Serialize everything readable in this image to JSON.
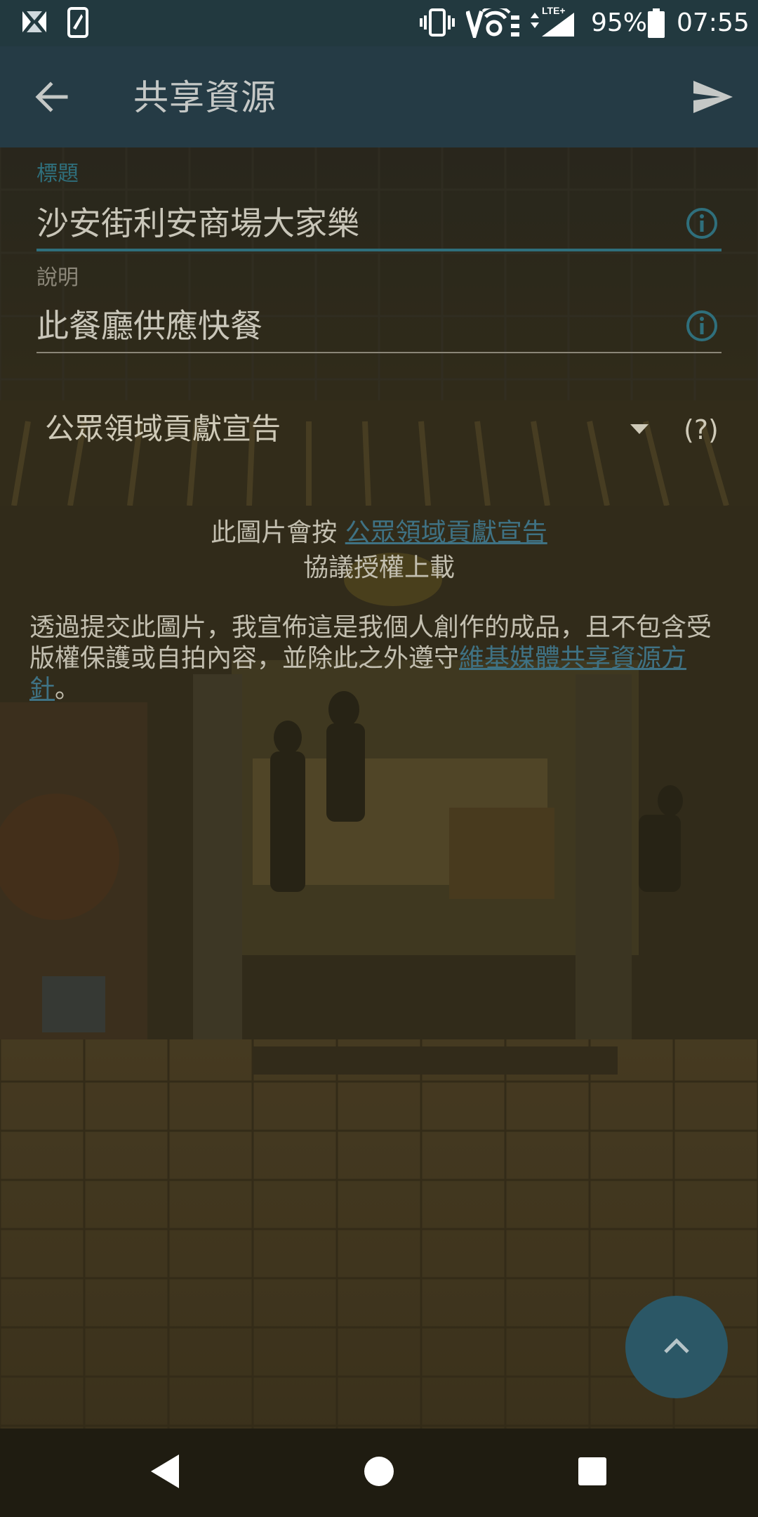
{
  "status_bar": {
    "battery_percent": "95%",
    "time": "07:55",
    "network_label": "LTE+",
    "left_icons": [
      "app-notification-icon",
      "device-notification-icon"
    ],
    "right_icons": [
      "vibrate-icon",
      "volte-wifi-icon",
      "lte-signal-icon",
      "battery-icon"
    ]
  },
  "toolbar": {
    "title": "共享資源",
    "back_icon": "arrow-left-icon",
    "send_icon": "send-icon"
  },
  "form": {
    "title_field": {
      "label": "標題",
      "value": "沙安街利安商場大家樂"
    },
    "description_field": {
      "label": "說明",
      "value": "此餐廳供應快餐"
    },
    "license": {
      "selected": "公眾領域貢獻宣告",
      "help": "(?)",
      "notice_prefix": "此圖片會按",
      "notice_link": "公眾領域貢獻宣告",
      "notice_suffix": "協議授權上載"
    },
    "declaration": {
      "text": "透過提交此圖片，我宣佈這是我個人創作的成品，且不包含受版權保護或自拍內容，並除此之外遵守",
      "link": "維基媒體共享資源方針",
      "end": "。"
    }
  },
  "fab": {
    "icon": "chevron-up-icon"
  },
  "nav_bar": {
    "icons": [
      "back-triangle-icon",
      "home-circle-icon",
      "recents-square-icon"
    ]
  },
  "colors": {
    "status_bar": "#22393f",
    "toolbar": "#253b45",
    "accent": "#2f6f7c",
    "link": "#3f7284",
    "fab": "#2b5766",
    "nav_bar": "#1f1c11"
  }
}
